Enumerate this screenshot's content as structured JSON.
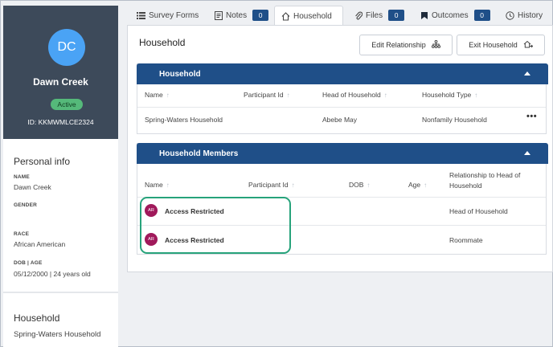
{
  "profile": {
    "initials": "DC",
    "name": "Dawn Creek",
    "status": "Active",
    "id_text": "ID: KKMWMLCE2324"
  },
  "personal_info": {
    "title": "Personal info",
    "name_label": "NAME",
    "name_value": "Dawn Creek",
    "gender_label": "GENDER",
    "gender_value": "",
    "race_label": "RACE",
    "race_value": "African American",
    "dob_label": "DOB | AGE",
    "dob_value": "05/12/2000 | 24 years old"
  },
  "sidebar_household": {
    "title": "Household",
    "value": "Spring-Waters Household"
  },
  "tabs": [
    {
      "label": "Survey Forms",
      "icon": "list-icon",
      "count": null
    },
    {
      "label": "Notes",
      "icon": "notes-icon",
      "count": "0"
    },
    {
      "label": "Household",
      "icon": "home-icon",
      "count": null,
      "active": true
    },
    {
      "label": "Files",
      "icon": "paperclip-icon",
      "count": "0"
    },
    {
      "label": "Outcomes",
      "icon": "flag-icon",
      "count": "0"
    },
    {
      "label": "History",
      "icon": "clock-icon",
      "count": null
    }
  ],
  "main": {
    "title": "Household",
    "edit_relationship_label": "Edit Relationship",
    "exit_household_label": "Exit Household"
  },
  "household_card": {
    "title": "Household",
    "columns": [
      "Name",
      "Participant Id",
      "Head of Household",
      "Household Type"
    ],
    "row": {
      "name": "Spring-Waters Household",
      "participant_id": "",
      "head": "Abebe May",
      "type": "Nonfamily Household"
    }
  },
  "members_card": {
    "title": "Household Members",
    "columns": [
      "Name",
      "Participant Id",
      "DOB",
      "Age",
      "Relationship to Head of Household"
    ],
    "rows": [
      {
        "initials": "AR",
        "name": "Access Restricted",
        "relationship": "Head of Household"
      },
      {
        "initials": "AR",
        "name": "Access Restricted",
        "relationship": "Roommate"
      }
    ]
  },
  "colors": {
    "sidebar_header": "#3d4a5a",
    "avatar": "#4aa3f5",
    "status_active": "#55b97a",
    "brand_blue": "#1f4f88",
    "restricted_avatar": "#a0195b",
    "highlight": "#27a37b"
  }
}
